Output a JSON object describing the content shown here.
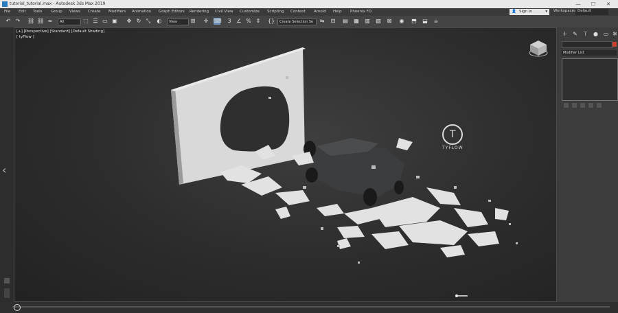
{
  "window": {
    "title": "tutorial_tutorial.max - Autodesk 3ds Max 2019",
    "controls": {
      "minimize": "—",
      "maximize": "☐",
      "close": "✕"
    }
  },
  "menu": {
    "items": [
      "File",
      "Edit",
      "Tools",
      "Group",
      "Views",
      "Create",
      "Modifiers",
      "Animation",
      "Graph Editors",
      "Rendering",
      "Civil View",
      "Customize",
      "Scripting",
      "Content",
      "Arnold",
      "Help",
      "Phoenix FD"
    ]
  },
  "account": {
    "signin_label": "Sign In",
    "workspace_label": "Workspaces:",
    "workspace_value": "Default"
  },
  "toolbar": {
    "filter_value": "All",
    "view_value": "View",
    "selection_set_placeholder": "Create Selection Se"
  },
  "viewport": {
    "label_line1": "[+] [Perspective] [Standard] [Default Shading]",
    "label_line2": "[ tyFlow ]",
    "logo_text": "TYFLOW",
    "logo_glyph": "T"
  },
  "command_panel": {
    "modifier_list_label": "Modifier List",
    "accent_color": "#c8402e"
  },
  "icons": {
    "undo": "↶",
    "redo": "↷",
    "link": "⛓",
    "select": "⬚",
    "move": "✥",
    "rotate": "↻",
    "scale": "⤡",
    "snap": "3",
    "nav_left": "‹",
    "nav_right": "›"
  }
}
